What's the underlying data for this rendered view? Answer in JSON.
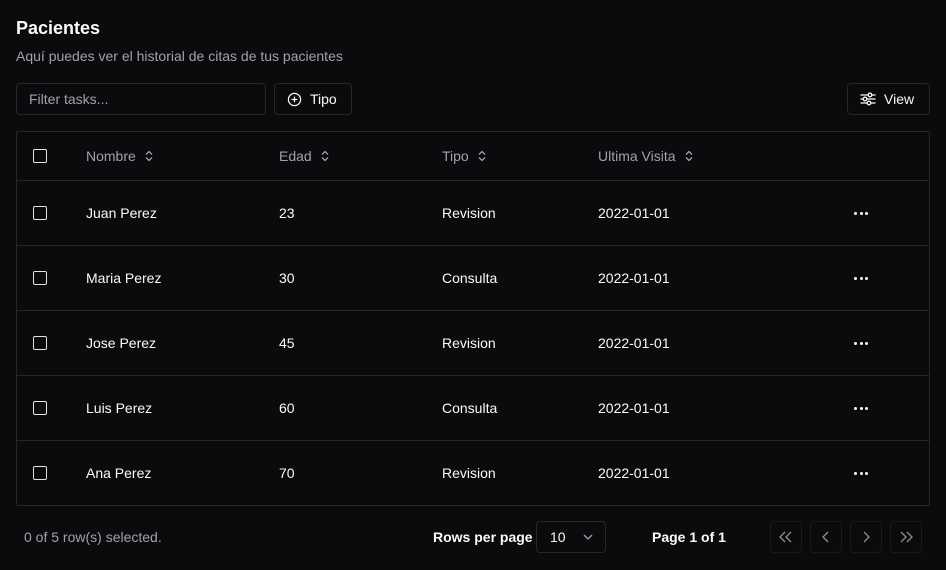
{
  "header": {
    "title": "Pacientes",
    "subtitle": "Aquí puedes ver el historial de citas de tus pacientes"
  },
  "toolbar": {
    "filter_placeholder": "Filter tasks...",
    "filter_value": "",
    "tipo_label": "Tipo",
    "view_label": "View"
  },
  "table": {
    "columns": [
      "Nombre",
      "Edad",
      "Tipo",
      "Ultima Visita"
    ],
    "rows": [
      {
        "nombre": "Juan Perez",
        "edad": "23",
        "tipo": "Revision",
        "visita": "2022-01-01"
      },
      {
        "nombre": "Maria Perez",
        "edad": "30",
        "tipo": "Consulta",
        "visita": "2022-01-01"
      },
      {
        "nombre": "Jose Perez",
        "edad": "45",
        "tipo": "Revision",
        "visita": "2022-01-01"
      },
      {
        "nombre": "Luis Perez",
        "edad": "60",
        "tipo": "Consulta",
        "visita": "2022-01-01"
      },
      {
        "nombre": "Ana Perez",
        "edad": "70",
        "tipo": "Revision",
        "visita": "2022-01-01"
      }
    ]
  },
  "footer": {
    "selected_text": "0 of 5 row(s) selected.",
    "rows_per_page_label": "Rows per page",
    "rows_per_page_value": "10",
    "page_text": "Page 1 of 1"
  },
  "icons": {
    "tipo": "plus-circle-icon",
    "view": "sliders-icon",
    "sort": "chevrons-up-down-icon",
    "row_actions": "ellipsis-icon",
    "select": "chevron-down-icon",
    "first": "chevrons-left-icon",
    "prev": "chevron-left-icon",
    "next": "chevron-right-icon",
    "last": "chevrons-right-icon"
  },
  "colors": {
    "background": "#0b0b0d",
    "border": "#27272a",
    "text": "#fafafa",
    "muted_text": "#a1a1aa"
  }
}
